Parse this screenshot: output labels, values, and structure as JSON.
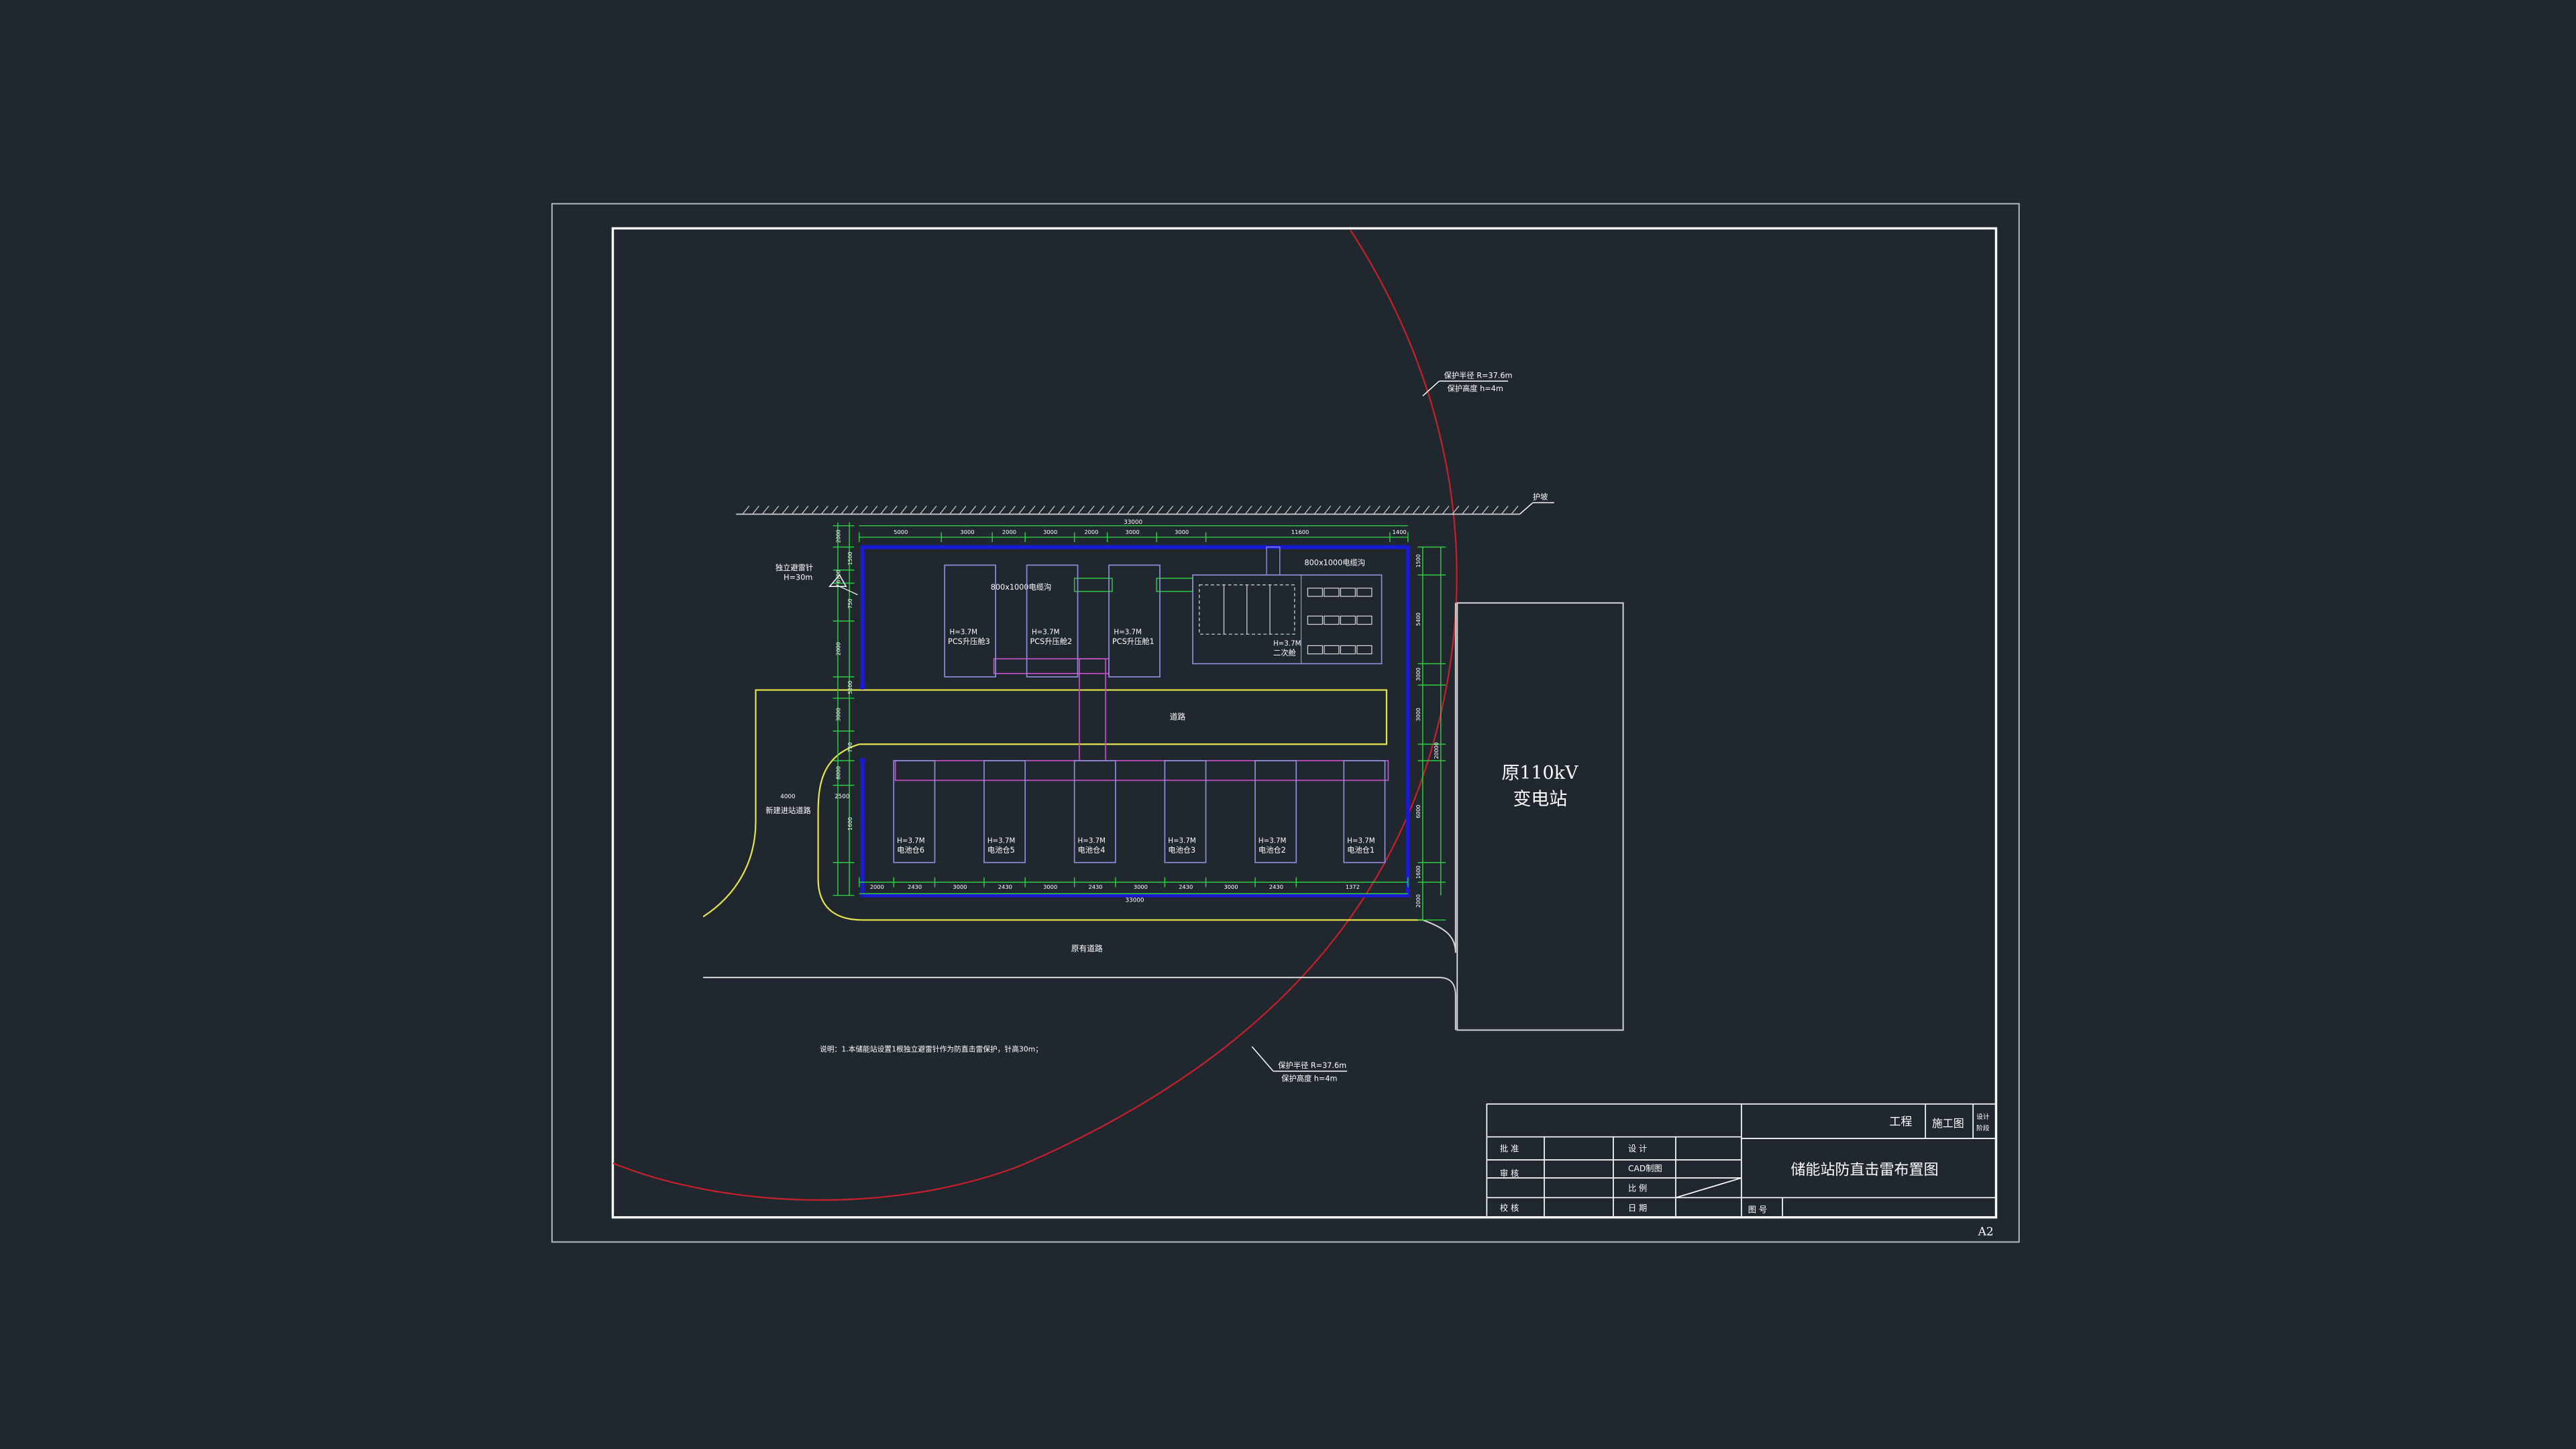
{
  "sheet": {
    "size_label": "A2"
  },
  "labels": {
    "protection_radius_top_1": "保护半径 R=37.6m",
    "protection_radius_top_2": "保护高度 h=4m",
    "protection_radius_bottom_1": "保护半径 R=37.6m",
    "protection_radius_bottom_2": "保护高度 h=4m",
    "slope": "护坡",
    "lightning_rod_1": "独立避雷针",
    "lightning_rod_2": "H=30m",
    "cable_trench_left": "800x1000电缆沟",
    "cable_trench_right": "800x1000电缆沟",
    "road": "道路",
    "new_road": "新建进站道路",
    "old_road": "原有道路",
    "substation_1": "原110kV",
    "substation_2": "变电站",
    "note": "说明：1.本储能站设置1根独立避雷针作为防直击雷保护，针高30m；",
    "secondary_cabin": "二次舱",
    "pcs": [
      {
        "h": "H=3.7M",
        "name": "PCS升压舱3"
      },
      {
        "h": "H=3.7M",
        "name": "PCS升压舱2"
      },
      {
        "h": "H=3.7M",
        "name": "PCS升压舱1"
      }
    ],
    "secondary_h": "H=3.7M",
    "batteries": [
      {
        "h": "H=3.7M",
        "name": "电池仓6"
      },
      {
        "h": "H=3.7M",
        "name": "电池仓5"
      },
      {
        "h": "H=3.7M",
        "name": "电池仓4"
      },
      {
        "h": "H=3.7M",
        "name": "电池仓3"
      },
      {
        "h": "H=3.7M",
        "name": "电池仓2"
      },
      {
        "h": "H=3.7M",
        "name": "电池仓1"
      }
    ]
  },
  "dimensions": {
    "top_total": "33000",
    "top_segments": [
      "5000",
      "3000",
      "2000",
      "3000",
      "2000",
      "3000",
      "3000",
      "11600",
      "1400"
    ],
    "bottom_total": "33000",
    "bottom_segments": [
      "2000",
      "2430",
      "3000",
      "2430",
      "3000",
      "2430",
      "3000",
      "2430",
      "3000",
      "2430",
      "1372"
    ],
    "left_vertical": [
      "2000",
      "1500",
      "6700",
      "750",
      "2000",
      "5500",
      "3000",
      "750",
      "8000",
      "1600"
    ],
    "right_vertical": [
      "1500",
      "5400",
      "3000",
      "3000",
      "20000",
      "6000",
      "1600",
      "2000"
    ],
    "road_width_label": "4000",
    "road_radius_label": "2500"
  },
  "title_block": {
    "project": "工程",
    "stage": "施工图",
    "stage_label_1": "设计",
    "stage_label_2": "阶段",
    "approve": "批  准",
    "review": "审  核",
    "check": "校  核",
    "design": "设 计",
    "cad": "CAD制图",
    "scale": "比  例",
    "date": "日  期",
    "drawing_title": "储能站防直击雷布置图",
    "drawing_no": "图  号"
  },
  "colors": {
    "background": "#20272e",
    "frame": "#ffffff",
    "dimension": "#2ecc40",
    "wall": "#1a1ad6",
    "road": "#e5e54a",
    "equipment": "#8c8cd9",
    "trench": "#c04fc0",
    "protection": "#c8202a"
  }
}
